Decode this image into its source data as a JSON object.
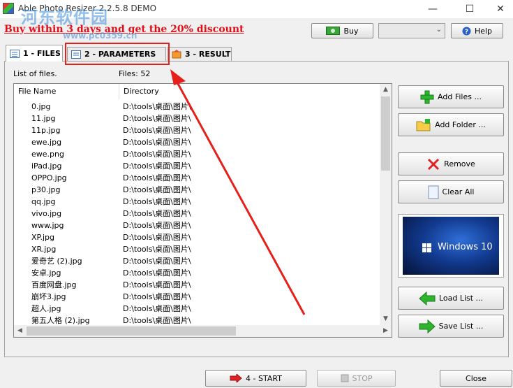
{
  "window": {
    "title": "Able Photo Resizer 2.2.5.8 DEMO",
    "minimize": "—",
    "maximize": "☐",
    "close": "✕"
  },
  "promo": {
    "text": "Buy within 3 days and get the 20% discount"
  },
  "watermark": {
    "text": "河东软件园",
    "url": "www.pc0359.cn"
  },
  "toolbar": {
    "buy_label": "Buy",
    "help_label": "Help",
    "dropdown_value": ""
  },
  "tabs": [
    {
      "number": "1",
      "label": "1 - FILES",
      "active": true
    },
    {
      "number": "2",
      "label": "2 - PARAMETERS",
      "active": false
    },
    {
      "number": "3",
      "label": "3 - RESULT",
      "active": false
    }
  ],
  "files": {
    "list_label": "List of files.",
    "count_label": "Files: 52",
    "columns": [
      "File Name",
      "Directory"
    ],
    "rows": [
      {
        "name": "0.jpg",
        "dir": "D:\\tools\\桌面\\图片\\"
      },
      {
        "name": "11.jpg",
        "dir": "D:\\tools\\桌面\\图片\\"
      },
      {
        "name": "11p.jpg",
        "dir": "D:\\tools\\桌面\\图片\\"
      },
      {
        "name": "ewe.jpg",
        "dir": "D:\\tools\\桌面\\图片\\"
      },
      {
        "name": "ewe.png",
        "dir": "D:\\tools\\桌面\\图片\\"
      },
      {
        "name": "iPad.jpg",
        "dir": "D:\\tools\\桌面\\图片\\"
      },
      {
        "name": "OPPO.jpg",
        "dir": "D:\\tools\\桌面\\图片\\"
      },
      {
        "name": "p30.jpg",
        "dir": "D:\\tools\\桌面\\图片\\"
      },
      {
        "name": "qq.jpg",
        "dir": "D:\\tools\\桌面\\图片\\"
      },
      {
        "name": "vivo.jpg",
        "dir": "D:\\tools\\桌面\\图片\\"
      },
      {
        "name": "www.jpg",
        "dir": "D:\\tools\\桌面\\图片\\"
      },
      {
        "name": "XP.jpg",
        "dir": "D:\\tools\\桌面\\图片\\"
      },
      {
        "name": "XR.jpg",
        "dir": "D:\\tools\\桌面\\图片\\"
      },
      {
        "name": "爱奇艺 (2).jpg",
        "dir": "D:\\tools\\桌面\\图片\\"
      },
      {
        "name": "安卓.jpg",
        "dir": "D:\\tools\\桌面\\图片\\"
      },
      {
        "name": "百度网盘.jpg",
        "dir": "D:\\tools\\桌面\\图片\\"
      },
      {
        "name": "崩坏3.jpg",
        "dir": "D:\\tools\\桌面\\图片\\"
      },
      {
        "name": "超人.jpg",
        "dir": "D:\\tools\\桌面\\图片\\"
      },
      {
        "name": "第五人格 (2).jpg",
        "dir": "D:\\tools\\桌面\\图片\\"
      }
    ]
  },
  "side_buttons": {
    "add_files": "Add Files ...",
    "add_folder": "Add Folder ...",
    "remove": "Remove",
    "clear_all": "Clear All",
    "load_list": "Load List ...",
    "save_list": "Save List ..."
  },
  "preview": {
    "text": "Windows 10"
  },
  "bottom": {
    "start": "4 - START",
    "stop": "STOP",
    "close": "Close"
  },
  "colors": {
    "promo": "#e0101a",
    "annotation": "#e5201a",
    "green_icon": "#2db52d",
    "remove_icon": "#e22222"
  }
}
